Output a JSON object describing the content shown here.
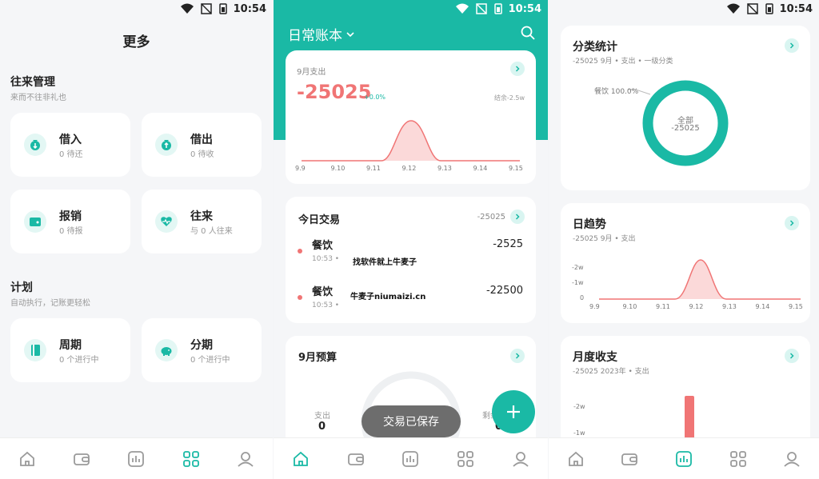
{
  "status": {
    "time": "10:54"
  },
  "more": {
    "title": "更多",
    "section1": {
      "title": "往来管理",
      "subtitle": "来而不往非礼也"
    },
    "tiles1": [
      {
        "label": "借入",
        "status": "0 待还"
      },
      {
        "label": "借出",
        "status": "0 待收"
      },
      {
        "label": "报销",
        "status": "0 待报"
      },
      {
        "label": "往来",
        "status": "与 0 人往来"
      }
    ],
    "section2": {
      "title": "计划",
      "subtitle": "自动执行，记账更轻松"
    },
    "tiles2": [
      {
        "label": "周期",
        "status": "0 个进行中"
      },
      {
        "label": "分期",
        "status": "0 个进行中"
      }
    ]
  },
  "ledger": {
    "book_name": "日常账本",
    "summary": {
      "period_label": "9月支出",
      "amount": "-25025",
      "change": "+0.0%",
      "balance": "结余-2.5w",
      "x_ticks": [
        "9.9",
        "9.10",
        "9.11",
        "9.12",
        "9.13",
        "9.14",
        "9.15"
      ]
    },
    "today": {
      "title": "今日交易",
      "total": "-25025",
      "items": [
        {
          "category": "餐饮",
          "time": "10:53 •",
          "amount": "-2525"
        },
        {
          "category": "餐饮",
          "time": "10:53 •",
          "amount": "-22500"
        }
      ]
    },
    "budget": {
      "title": "9月预算",
      "spent_label": "支出",
      "spent_value": "0",
      "remain_label": "剩余",
      "remain_value": "0"
    },
    "toast": "交易已保存",
    "watermark1": "找软件就上牛麦子",
    "watermark2": "牛麦子niumaizi.cn"
  },
  "stats": {
    "category": {
      "title": "分类统计",
      "subtitle": "-25025   9月 • 支出 • 一级分类",
      "slice_label": "餐饮 100.0%",
      "center_label": "全部",
      "center_value": "-25025"
    },
    "daily": {
      "title": "日趋势",
      "subtitle": "-25025   9月 • 支出",
      "y_ticks": [
        "-2w",
        "-1w",
        "0"
      ],
      "x_ticks": [
        "9.9",
        "9.10",
        "9.11",
        "9.12",
        "9.13",
        "9.14",
        "9.15"
      ]
    },
    "monthly": {
      "title": "月度收支",
      "subtitle": "-25025   2023年 • 支出",
      "y_ticks": [
        "-2w",
        "-1w"
      ]
    }
  },
  "nav": [
    "home-icon",
    "wallet-icon",
    "chart-icon",
    "grid-icon",
    "profile-icon"
  ],
  "colors": {
    "accent": "#1ab9a5",
    "expense": "#f07575"
  }
}
